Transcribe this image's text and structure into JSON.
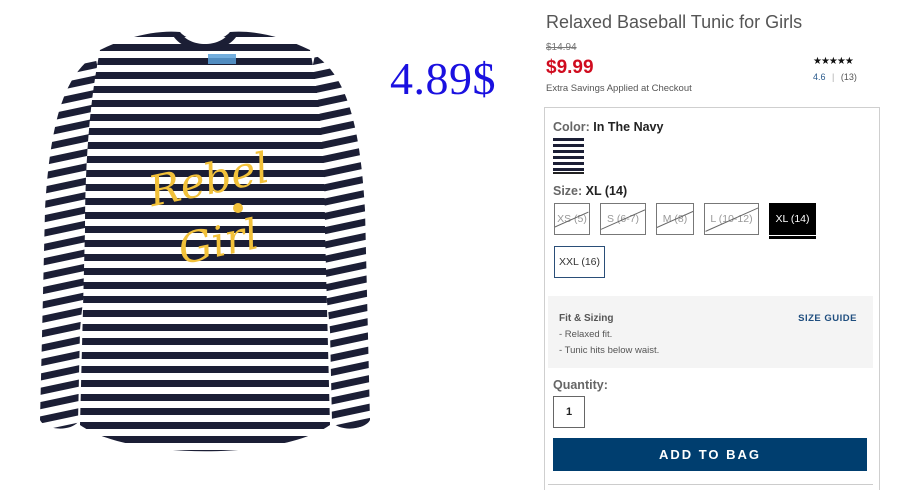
{
  "overlay": {
    "promo_price": "4.89$"
  },
  "product": {
    "title": "Relaxed Baseball Tunic for Girls",
    "original_price": "$14.94",
    "sale_price": "$9.99",
    "savings_note": "Extra Savings Applied at Checkout",
    "rating": {
      "stars": "★★★★★",
      "value": "4.6",
      "separator": "|",
      "count": "(13)"
    },
    "image_text": "Rebel Girl"
  },
  "color": {
    "label": "Color:",
    "value": "In The Navy"
  },
  "size": {
    "label": "Size:",
    "value": "XL (14)",
    "options": [
      {
        "label": "XS (5)",
        "state": "unavailable"
      },
      {
        "label": "S (6-7)",
        "state": "unavailable"
      },
      {
        "label": "M (8)",
        "state": "unavailable"
      },
      {
        "label": "L (10-12)",
        "state": "unavailable"
      },
      {
        "label": "XL (14)",
        "state": "selected"
      },
      {
        "label": "XXL (16)",
        "state": "available"
      }
    ]
  },
  "fit": {
    "title": "Fit & Sizing",
    "guide_link": "SIZE GUIDE",
    "items": [
      "- Relaxed fit.",
      "- Tunic hits below waist."
    ]
  },
  "quantity": {
    "label": "Quantity:",
    "value": "1"
  },
  "actions": {
    "add_to_bag": "ADD TO BAG"
  },
  "colors": {
    "accent": "#003e6f",
    "sale": "#d00c1f",
    "promo": "#1a10e0",
    "navy_stripe": "#1b1e35",
    "print": "#f2c13a"
  }
}
